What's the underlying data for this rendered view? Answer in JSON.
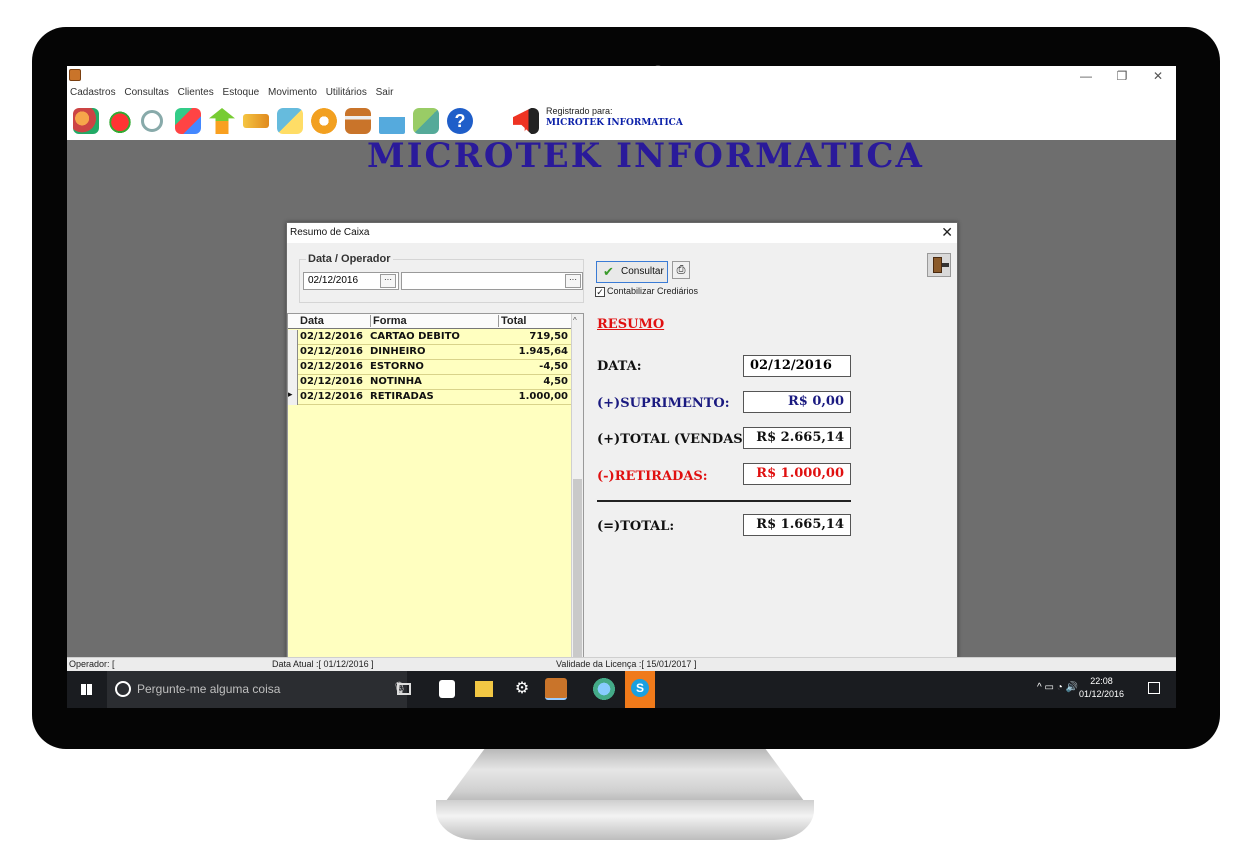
{
  "app": {
    "menu": [
      "Cadastros",
      "Consultas",
      "Clientes",
      "Estoque",
      "Movimento",
      "Utilitários",
      "Sair"
    ],
    "registered_label": "Registrado para:",
    "registered_name": "MICROTEK INFORMATICA",
    "background_title": "MICROTEK INFORMATICA"
  },
  "dialog": {
    "title": "Resumo de Caixa",
    "group_label": "Data / Operador",
    "date_value": "02/12/2016",
    "operator_value": "",
    "consultar_label": "Consultar",
    "checkbox_label": "Contabilizar Crediários",
    "checkbox_checked": true
  },
  "grid": {
    "headers": [
      "Data",
      "Forma",
      "Total"
    ],
    "rows": [
      [
        "02/12/2016",
        "CARTAO DEBITO",
        "719,50"
      ],
      [
        "02/12/2016",
        "DINHEIRO",
        "1.945,64"
      ],
      [
        "02/12/2016",
        "ESTORNO",
        "-4,50"
      ],
      [
        "02/12/2016",
        "NOTINHA",
        "4,50"
      ],
      [
        "02/12/2016",
        "RETIRADAS",
        "1.000,00"
      ]
    ]
  },
  "summary": {
    "title": "RESUMO",
    "data_label": "DATA:",
    "data_value": "02/12/2016",
    "suprimento_label": "(+)SUPRIMENTO:",
    "suprimento_value": "R$ 0,00",
    "vendas_label": "(+)TOTAL (VENDAS):",
    "vendas_value": "R$ 2.665,14",
    "retiradas_label": "(-)RETIRADAS:",
    "retiradas_value": "R$ 1.000,00",
    "total_label": "(=)TOTAL:",
    "total_value": "R$ 1.665,14"
  },
  "status": {
    "operador": "Operador: [",
    "data_atual": "Data Atual :[ 01/12/2016 ]",
    "validade": "Validade da Licença :[ 15/01/2017 ]"
  },
  "taskbar": {
    "search_placeholder": "Pergunte-me alguma coisa",
    "time": "22:08",
    "date": "01/12/2016"
  },
  "colors": {
    "grid_bg": "#ffffc0",
    "label_blue": "#1a1a80",
    "label_red": "#e01010",
    "accent": "#3a7bd5"
  }
}
